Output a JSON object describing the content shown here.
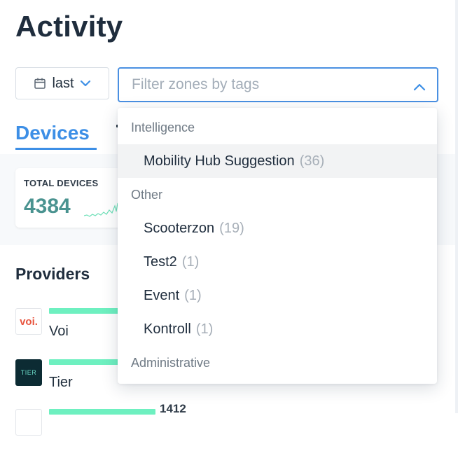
{
  "page": {
    "title": "Activity"
  },
  "toolbar": {
    "date_button": {
      "icon": "calendar-icon",
      "label": "last"
    },
    "filter": {
      "placeholder": "Filter zones by tags"
    }
  },
  "tabs": {
    "devices": "Devices"
  },
  "stats": {
    "total_devices": {
      "label": "TOTAL DEVICES",
      "value": "4384"
    }
  },
  "providers": {
    "heading": "Providers",
    "items": [
      {
        "logo": "voi.",
        "name": "Voi"
      },
      {
        "logo": "TIER",
        "name": "Tier"
      },
      {
        "logo": "",
        "name": "",
        "value": "1412"
      }
    ]
  },
  "dropdown": {
    "groups": [
      {
        "label": "Intelligence",
        "options": [
          {
            "label": "Mobility Hub Suggestion",
            "count": "(36)",
            "highlighted": true
          }
        ]
      },
      {
        "label": "Other",
        "options": [
          {
            "label": "Scooterzon",
            "count": "(19)"
          },
          {
            "label": "Test2",
            "count": "(1)"
          },
          {
            "label": "Event",
            "count": "(1)"
          },
          {
            "label": "Kontroll",
            "count": "(1)"
          }
        ]
      },
      {
        "label": "Administrative",
        "options": []
      }
    ]
  },
  "colors": {
    "accent": "#3d8fe6",
    "focus_border": "#4a90e2",
    "stat_value": "#4a9390",
    "provider_bar": "#6ef0c0"
  }
}
